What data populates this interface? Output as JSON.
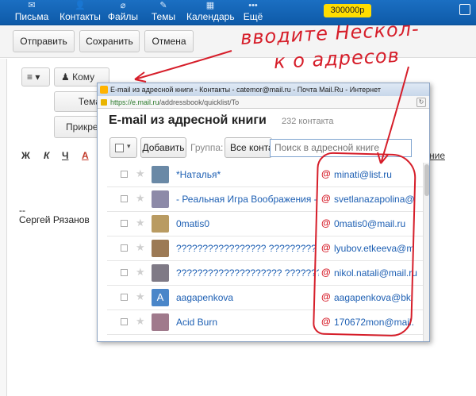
{
  "nav": {
    "items": [
      {
        "label": "Письма",
        "icon": "envelope-icon"
      },
      {
        "label": "Контакты",
        "icon": "person-icon"
      },
      {
        "label": "Файлы",
        "icon": "paperclip-icon"
      },
      {
        "label": "Темы",
        "icon": "brush-icon"
      },
      {
        "label": "Календарь",
        "icon": "calendar-icon"
      },
      {
        "label": "Ещё",
        "icon": "more-dots-icon"
      }
    ],
    "balance": "300000р"
  },
  "toolbar": {
    "send": "Отправить",
    "save": "Сохранить",
    "cancel": "Отмена"
  },
  "compose": {
    "to_label": "Кому",
    "subject_label": "Тема",
    "attach_label": "Прикреп",
    "format": {
      "bold": "Ж",
      "italic": "К",
      "underline": "Ч",
      "color": "А"
    },
    "right_fragment": "ние",
    "signature_dash": "--",
    "signature_name": "Сергей Рязанов"
  },
  "annotation": {
    "line1": "вводите Нескол-",
    "line2": "к о адресов",
    "color": "#d61e2a"
  },
  "popup": {
    "window_title": "E-mail из адресной книги - Контакты - catemor@mail.ru - Почта Mail.Ru - Интернет",
    "url_host": "https://e.mail.ru",
    "url_path": "/addressbook/quicklist/To",
    "heading": "E-mail из адресной книги",
    "count": "232 контакта",
    "add_button": "Добавить",
    "group_label": "Группа:",
    "group_value": "Все контакты",
    "search_placeholder": "Поиск в адресной книге",
    "contacts": [
      {
        "name": "*Наталья*",
        "email": "minati@list.ru",
        "avatar_color": "#6a89a6",
        "avatar_letter": ""
      },
      {
        "name": "- Реальная Игра Воображения -",
        "email": "svetlanazapolina@",
        "avatar_color": "#8d8aa8",
        "avatar_letter": ""
      },
      {
        "name": "0matis0",
        "email": "0matis0@mail.ru",
        "avatar_color": "#b99b62",
        "avatar_letter": ""
      },
      {
        "name": "????????????????? ?????????",
        "email": "lyubov.etkeeva@m",
        "avatar_color": "#9c7a55",
        "avatar_letter": ""
      },
      {
        "name": "???????????????????? ?????????",
        "email": "nikol.natali@mail.ru",
        "avatar_color": "#7f7a86",
        "avatar_letter": ""
      },
      {
        "name": "aagapenkova",
        "email": "aagapenkova@bk.",
        "avatar_color": "#4a86c9",
        "avatar_letter": "A"
      },
      {
        "name": "Acid Burn",
        "email": "170672mon@mail.",
        "avatar_color": "#a07a8c",
        "avatar_letter": ""
      }
    ]
  }
}
